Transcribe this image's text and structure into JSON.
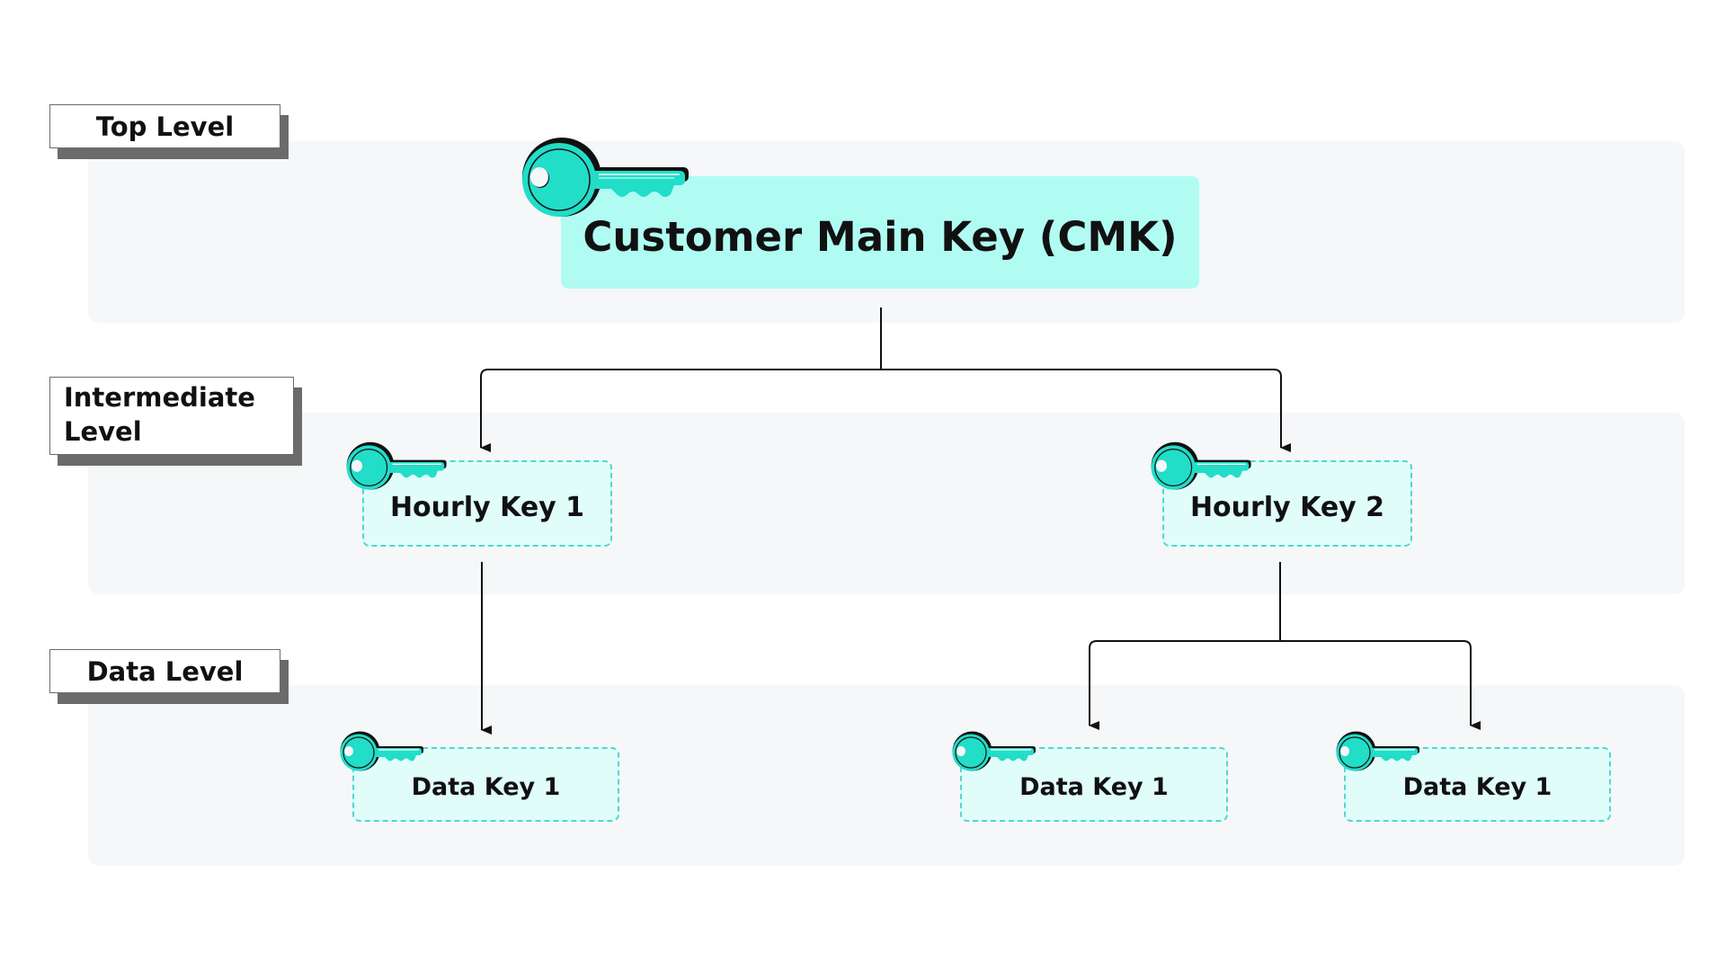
{
  "levels": {
    "top": "Top Level",
    "intermediate_line1": "Intermediate",
    "intermediate_line2": "Level",
    "data": "Data Level"
  },
  "nodes": {
    "cmk": "Customer Main Key (CMK)",
    "hourly_key_1": "Hourly Key 1",
    "hourly_key_2": "Hourly Key 2",
    "data_key_a": "Data Key 1",
    "data_key_b": "Data Key 1",
    "data_key_c": "Data Key 1"
  },
  "edges": [
    {
      "from": "cmk",
      "to": "hourly_key_1"
    },
    {
      "from": "cmk",
      "to": "hourly_key_2"
    },
    {
      "from": "hourly_key_1",
      "to": "data_key_a"
    },
    {
      "from": "hourly_key_2",
      "to": "data_key_b"
    },
    {
      "from": "hourly_key_2",
      "to": "data_key_c"
    }
  ],
  "icons": {
    "key": "key-icon"
  },
  "colors": {
    "key_teal": "#22ddc8",
    "cmk_fill": "#b0fcf3",
    "key_box_fill": "#e0fdfa",
    "key_box_border": "#4ed9cc",
    "band": "#f6f7f9",
    "label_shadow": "#6b6b6b"
  }
}
